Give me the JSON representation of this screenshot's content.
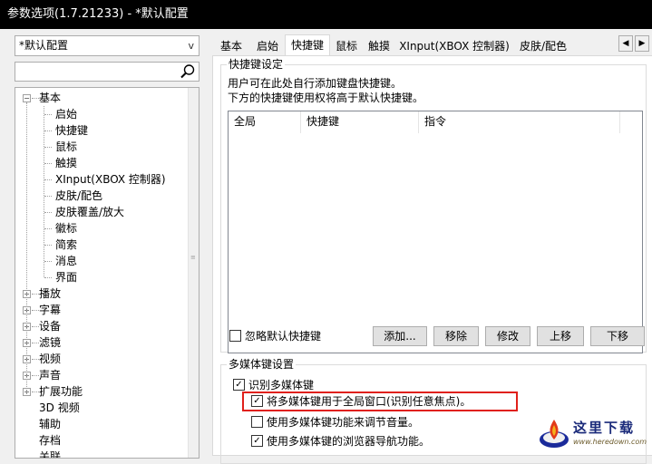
{
  "window": {
    "title": "参数选项(1.7.21233) - *默认配置"
  },
  "left_panel": {
    "preset_value": "*默认配置",
    "search_placeholder": "",
    "tree": [
      {
        "label": "基本",
        "level": 0,
        "expander": "-"
      },
      {
        "label": "启始",
        "level": 1
      },
      {
        "label": "快捷键",
        "level": 1,
        "selected": true
      },
      {
        "label": "鼠标",
        "level": 1
      },
      {
        "label": "触摸",
        "level": 1
      },
      {
        "label": "XInput(XBOX 控制器)",
        "level": 1
      },
      {
        "label": "皮肤/配色",
        "level": 1
      },
      {
        "label": "皮肤覆盖/放大",
        "level": 1
      },
      {
        "label": "徽标",
        "level": 1
      },
      {
        "label": "简索",
        "level": 1
      },
      {
        "label": "消息",
        "level": 1
      },
      {
        "label": "界面",
        "level": 1
      },
      {
        "label": "播放",
        "level": 0,
        "expander": "+"
      },
      {
        "label": "字幕",
        "level": 0,
        "expander": "+"
      },
      {
        "label": "设备",
        "level": 0,
        "expander": "+"
      },
      {
        "label": "滤镜",
        "level": 0,
        "expander": "+"
      },
      {
        "label": "视频",
        "level": 0,
        "expander": "+"
      },
      {
        "label": "声音",
        "level": 0,
        "expander": "+"
      },
      {
        "label": "扩展功能",
        "level": 0,
        "expander": "+"
      },
      {
        "label": "3D 视频",
        "level": 0
      },
      {
        "label": "辅助",
        "level": 0
      },
      {
        "label": "存档",
        "level": 0
      },
      {
        "label": "关联",
        "level": 0
      }
    ]
  },
  "tabs": [
    {
      "label": "基本"
    },
    {
      "label": "启始"
    },
    {
      "label": "快捷键",
      "active": true
    },
    {
      "label": "鼠标"
    },
    {
      "label": "触摸"
    },
    {
      "label": "XInput(XBOX 控制器)"
    },
    {
      "label": "皮肤/配色"
    }
  ],
  "hotkey_group": {
    "title": "快捷键设定",
    "desc1": "用户可在此处自行添加键盘快捷键。",
    "desc2": "下方的快捷键使用权将高于默认快捷键。",
    "columns": [
      "全局",
      "快捷键",
      "指令"
    ],
    "ignore_default_label": "忽略默认快捷键",
    "ignore_default_checked": false,
    "buttons": {
      "add": "添加...",
      "remove": "移除",
      "edit": "修改",
      "up": "上移",
      "down": "下移"
    }
  },
  "media_group": {
    "title": "多媒体键设置",
    "recognize_label": "识别多媒体键",
    "recognize_checked": true,
    "global_label": "将多媒体键用于全局窗口(识别任意焦点)。",
    "global_checked": true,
    "volume_label": "使用多媒体键功能来调节音量。",
    "volume_checked": false,
    "browser_label": "使用多媒体键的浏览器导航功能。",
    "browser_checked": true
  },
  "watermark": {
    "text": "这里下载",
    "url": "www.heredown.com"
  },
  "colors": {
    "titlebar": "#000000",
    "highlight": "#e0201a",
    "window": "#f0f0f0"
  }
}
